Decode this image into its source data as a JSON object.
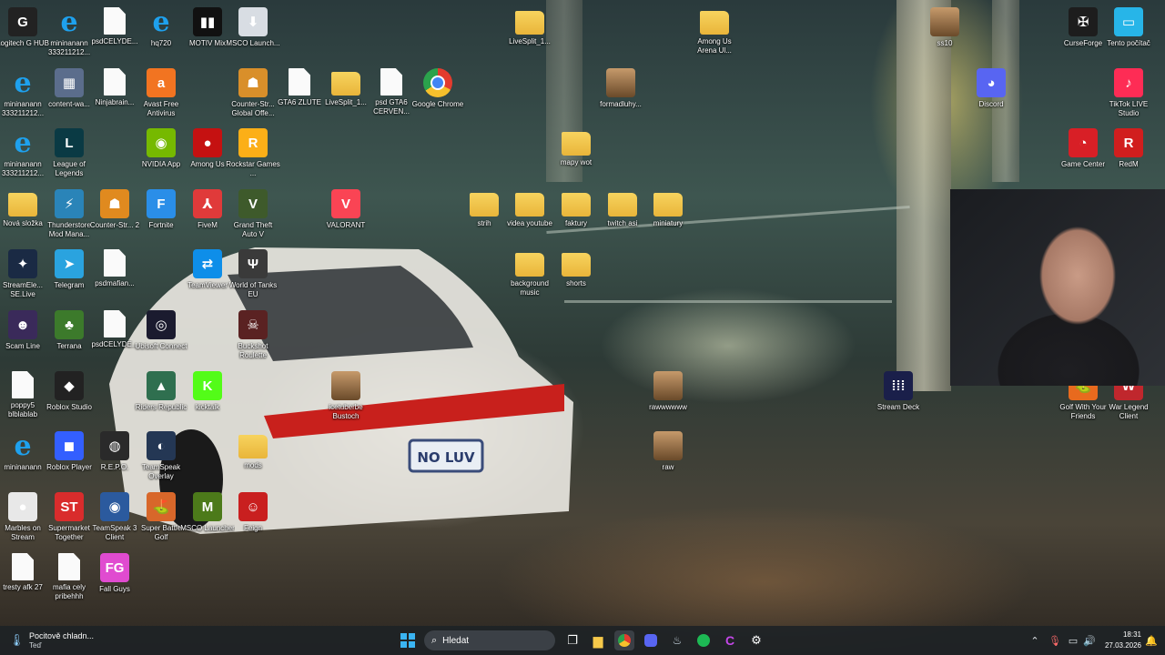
{
  "desktop": {
    "icons": [
      {
        "label": "Logitech G HUB",
        "glyph": "G",
        "bg": "#222222",
        "col": 0,
        "row": 0
      },
      {
        "label": "mininanann 333211212...",
        "glyph": "e",
        "kind": "ie",
        "col": 1,
        "row": 0
      },
      {
        "label": "psdCELYDE...",
        "kind": "file",
        "col": 2,
        "row": 0
      },
      {
        "label": "hq720",
        "glyph": "e",
        "kind": "ie",
        "col": 3,
        "row": 0
      },
      {
        "label": "MOTIV Mix",
        "glyph": "▮▮",
        "bg": "#111111",
        "col": 4,
        "row": 0
      },
      {
        "label": "MSCO Launch...",
        "glyph": "⬇",
        "bg": "#d8dde3",
        "col": 5,
        "row": 0
      },
      {
        "label": "mininanann 333211212...",
        "glyph": "e",
        "kind": "ie",
        "col": 0,
        "row": 1
      },
      {
        "label": "content-wa...",
        "glyph": "▦",
        "bg": "#5b6d8c",
        "col": 1,
        "row": 1
      },
      {
        "label": "Ninjabrain...",
        "kind": "file",
        "col": 2,
        "row": 1
      },
      {
        "label": "Avast Free Antivirus",
        "glyph": "a",
        "bg": "#f27421",
        "col": 3,
        "row": 1
      },
      {
        "label": "Counter-Str... Global Offe...",
        "glyph": "☗",
        "bg": "#d98f2a",
        "col": 5,
        "row": 1
      },
      {
        "label": "GTA6 ZLUTE",
        "kind": "file",
        "col": 6,
        "row": 1
      },
      {
        "label": "LiveSplit_1...",
        "kind": "folder",
        "col": 7,
        "row": 1
      },
      {
        "label": "psd GTA6 CERVEN...",
        "kind": "file",
        "col": 8,
        "row": 1
      },
      {
        "label": "Google Chrome",
        "kind": "chrome",
        "col": 9,
        "row": 1
      },
      {
        "label": "mininanann 333211212...",
        "glyph": "e",
        "kind": "ie",
        "col": 0,
        "row": 2
      },
      {
        "label": "League of Legends",
        "glyph": "L",
        "bg": "#0a3a44",
        "col": 1,
        "row": 2
      },
      {
        "label": "NVIDIA App",
        "glyph": "◉",
        "bg": "#76b900",
        "col": 3,
        "row": 2
      },
      {
        "label": "Among Us",
        "glyph": "●",
        "bg": "#c51111",
        "col": 4,
        "row": 2
      },
      {
        "label": "Rockstar Games ...",
        "glyph": "R",
        "bg": "#fcaf17",
        "col": 5,
        "row": 2
      },
      {
        "label": "Nová složka",
        "kind": "folder",
        "col": 0,
        "row": 3
      },
      {
        "label": "Thunderstore Mod Mana...",
        "glyph": "⚡",
        "bg": "#2a84b8",
        "col": 1,
        "row": 3
      },
      {
        "label": "Counter-Str... 2",
        "glyph": "☗",
        "bg": "#e08a1f",
        "col": 2,
        "row": 3
      },
      {
        "label": "Fortnite",
        "glyph": "F",
        "bg": "#2a8ee8",
        "col": 3,
        "row": 3
      },
      {
        "label": "FiveM",
        "glyph": "⅄",
        "bg": "#e03a3a",
        "col": 4,
        "row": 3
      },
      {
        "label": "Grand Theft Auto V",
        "glyph": "V",
        "bg": "#3e5a2b",
        "col": 5,
        "row": 3
      },
      {
        "label": "VALORANT",
        "glyph": "V",
        "bg": "#fa4454",
        "col": 7,
        "row": 3
      },
      {
        "label": "StreamEle... SE.Live",
        "glyph": "✦",
        "bg": "#1a2a44",
        "col": 0,
        "row": 4
      },
      {
        "label": "Telegram",
        "glyph": "➤",
        "bg": "#2aa3df",
        "col": 1,
        "row": 4
      },
      {
        "label": "psdmafian...",
        "kind": "file",
        "col": 2,
        "row": 4
      },
      {
        "label": "TeamViewer",
        "glyph": "⇄",
        "bg": "#0e8ee9",
        "col": 4,
        "row": 4
      },
      {
        "label": "World of Tanks EU",
        "glyph": "Ψ",
        "bg": "#3a3a3a",
        "col": 5,
        "row": 4
      },
      {
        "label": "Scam Line",
        "glyph": "☻",
        "bg": "#3a2a5a",
        "col": 0,
        "row": 5
      },
      {
        "label": "Terrana",
        "glyph": "♣",
        "bg": "#3c7a2b",
        "col": 1,
        "row": 5
      },
      {
        "label": "psdCELYDE...",
        "kind": "file",
        "col": 2,
        "row": 5
      },
      {
        "label": "Ubisoft Connect",
        "glyph": "◎",
        "bg": "#1b1b2f",
        "col": 3,
        "row": 5
      },
      {
        "label": "Buckshot Roulette",
        "glyph": "☠",
        "bg": "#5a2222",
        "col": 5,
        "row": 5
      },
      {
        "label": "poppy5 blblablab",
        "kind": "file",
        "col": 0,
        "row": 6
      },
      {
        "label": "Roblox Studio",
        "glyph": "◆",
        "bg": "#222222",
        "col": 1,
        "row": 6
      },
      {
        "label": "Riders Republic",
        "glyph": "▲",
        "bg": "#2f6f4f",
        "col": 3,
        "row": 6
      },
      {
        "label": "kicktalk",
        "glyph": "K",
        "bg": "#53fc18",
        "col": 4,
        "row": 6
      },
      {
        "label": "icetuberbe Bustoch",
        "kind": "img",
        "col": 7,
        "row": 6
      },
      {
        "label": "mininanann",
        "glyph": "e",
        "kind": "ie",
        "col": 0,
        "row": 7
      },
      {
        "label": "Roblox Player",
        "glyph": "◼",
        "bg": "#335fff",
        "col": 1,
        "row": 7
      },
      {
        "label": "R.E.P.O.",
        "glyph": "◍",
        "bg": "#2a2a2a",
        "col": 2,
        "row": 7
      },
      {
        "label": "TeamSpeak Overlay",
        "glyph": "◐",
        "bg": "#243754",
        "col": 3,
        "row": 7
      },
      {
        "label": "mods",
        "kind": "folder",
        "col": 5,
        "row": 7
      },
      {
        "label": "Marbles on Stream",
        "glyph": "●",
        "bg": "#e8e8e8",
        "col": 0,
        "row": 8
      },
      {
        "label": "Supermarket Together",
        "glyph": "ST",
        "bg": "#d92c2c",
        "col": 1,
        "row": 8
      },
      {
        "label": "TeamSpeak 3 Client",
        "glyph": "◉",
        "bg": "#2b5a9e",
        "col": 2,
        "row": 8
      },
      {
        "label": "Super Battle Golf",
        "glyph": "⛳",
        "bg": "#d8672a",
        "col": 3,
        "row": 8
      },
      {
        "label": "MSCO Launcher",
        "glyph": "M",
        "bg": "#4c7a1a",
        "col": 4,
        "row": 8
      },
      {
        "label": "Feign",
        "glyph": "☺",
        "bg": "#c91f1f",
        "col": 5,
        "row": 8
      },
      {
        "label": "tresty afk 27",
        "kind": "file",
        "col": 0,
        "row": 9
      },
      {
        "label": "mafia cely pribehhh",
        "kind": "file",
        "col": 1,
        "row": 9
      },
      {
        "label": "Fall Guys",
        "glyph": "FG",
        "bg": "#e04bd0",
        "col": 2,
        "row": 9
      }
    ],
    "free_icons": [
      {
        "label": "LiveSplit_1...",
        "kind": "folder",
        "slot": "a"
      },
      {
        "label": "Among Us Arena Ul...",
        "kind": "folder",
        "slot": "b"
      },
      {
        "label": "formadluhy...",
        "kind": "img",
        "slot": "c"
      },
      {
        "label": "mapy wot",
        "kind": "folder",
        "slot": "d"
      },
      {
        "label": "strih",
        "kind": "folder",
        "slot": "e"
      },
      {
        "label": "videa youtube",
        "kind": "folder",
        "slot": "f"
      },
      {
        "label": "faktury",
        "kind": "folder",
        "slot": "g"
      },
      {
        "label": "twitch asi",
        "kind": "folder",
        "slot": "h"
      },
      {
        "label": "miniatury",
        "kind": "folder",
        "slot": "i"
      },
      {
        "label": "background music",
        "kind": "folder",
        "slot": "j"
      },
      {
        "label": "shorts",
        "kind": "folder",
        "slot": "k"
      },
      {
        "label": "rawwwwww",
        "kind": "img",
        "slot": "l"
      },
      {
        "label": "raw",
        "kind": "img",
        "slot": "m"
      },
      {
        "label": "Stream Deck",
        "glyph": "⁞⁞⁞",
        "bg": "#1a1f4a",
        "slot": "n"
      },
      {
        "label": "CurseForge",
        "glyph": "✠",
        "bg": "#1d1d1d",
        "slot": "o"
      },
      {
        "label": "Tento počítač",
        "glyph": "▭",
        "bg": "#27b5e8",
        "slot": "p"
      },
      {
        "label": "Discord",
        "glyph": "◕",
        "bg": "#5865f2",
        "slot": "q"
      },
      {
        "label": "TikTok LIVE Studio",
        "glyph": "♪",
        "bg": "#fe2c55",
        "slot": "r"
      },
      {
        "label": "Game Center",
        "glyph": "◔",
        "bg": "#d81f26",
        "slot": "s"
      },
      {
        "label": "RedM",
        "glyph": "R",
        "bg": "#d11e1e",
        "slot": "t"
      },
      {
        "label": "Golf With Your Friends",
        "glyph": "⛳",
        "bg": "#e86a1e",
        "slot": "u"
      },
      {
        "label": "War Legend Client",
        "glyph": "W",
        "bg": "#c0272d",
        "slot": "v"
      },
      {
        "label": "ss10",
        "kind": "img",
        "slot": "w"
      }
    ]
  },
  "taskbar": {
    "weather_title": "Pocitově chladn...",
    "weather_sub": "Teď",
    "search_placeholder": "Hledat",
    "time": "18:31",
    "date": "27.03.2026"
  }
}
